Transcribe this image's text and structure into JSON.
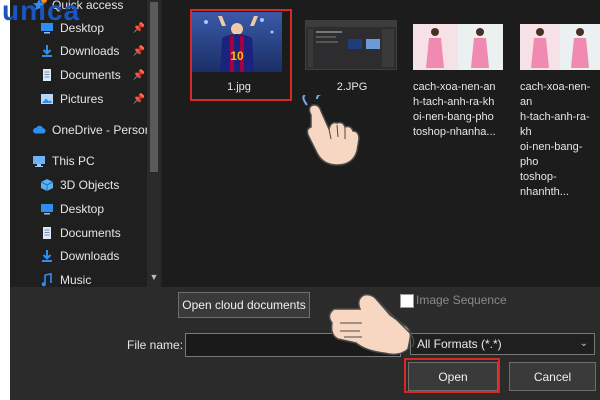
{
  "watermark": {
    "text": "unica"
  },
  "sidebar": {
    "items": [
      {
        "label": "Quick access",
        "icon": "star-icon"
      },
      {
        "label": "Desktop",
        "icon": "desktop-icon",
        "pinned": true
      },
      {
        "label": "Downloads",
        "icon": "download-icon",
        "pinned": true
      },
      {
        "label": "Documents",
        "icon": "document-icon",
        "pinned": true
      },
      {
        "label": "Pictures",
        "icon": "pictures-icon",
        "pinned": true
      },
      {
        "label": "OneDrive - Person",
        "icon": "cloud-icon"
      },
      {
        "label": "This PC",
        "icon": "computer-icon"
      },
      {
        "label": "3D Objects",
        "icon": "cube-icon"
      },
      {
        "label": "Desktop",
        "icon": "desktop-icon"
      },
      {
        "label": "Documents",
        "icon": "document-icon"
      },
      {
        "label": "Downloads",
        "icon": "download-icon"
      },
      {
        "label": "Music",
        "icon": "music-icon"
      }
    ]
  },
  "files": [
    {
      "name": "1.jpg",
      "number": "10"
    },
    {
      "name": "2.JPG"
    },
    {
      "name_lines": [
        "cach-xoa-nen-an",
        "h-tach-anh-ra-kh",
        "oi-nen-bang-pho",
        "toshop-nhanha..."
      ]
    },
    {
      "name_lines": [
        "cach-xoa-nen-an",
        "h-tach-anh-ra-kh",
        "oi-nen-bang-pho",
        "toshop-nhanhth..."
      ]
    }
  ],
  "bottom": {
    "cloud_button": "Open cloud documents",
    "image_sequence_label": "Image Sequence",
    "file_name_label": "File name:",
    "file_name_value": "",
    "format_value": "All Formats (*.*)",
    "open_button": "Open",
    "cancel_button": "Cancel"
  },
  "colors": {
    "highlight": "#d72824",
    "logo_blue": "#1a56c2",
    "logo_orange": "#f38a1b",
    "dialog_bg": "#2b2b2b",
    "sidebar_bg": "#1f1f1f"
  }
}
